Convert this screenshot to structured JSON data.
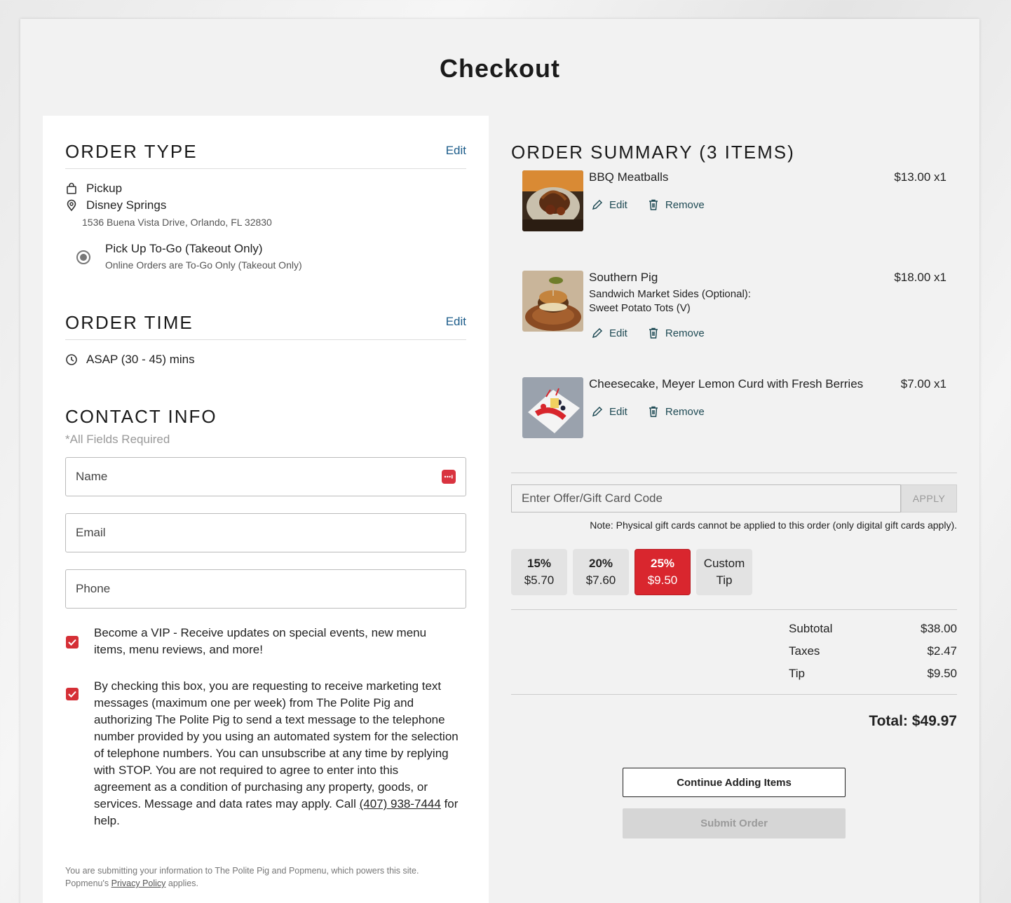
{
  "page": {
    "title": "Checkout"
  },
  "order_type": {
    "heading": "ORDER TYPE",
    "edit_label": "Edit",
    "method": "Pickup",
    "location": "Disney Springs",
    "address": "1536 Buena Vista Drive, Orlando, FL 32830",
    "option_label": "Pick Up To-Go (Takeout Only)",
    "option_sub": "Online Orders are To-Go Only (Takeout Only)"
  },
  "order_time": {
    "heading": "ORDER TIME",
    "edit_label": "Edit",
    "value": "ASAP (30 - 45) mins"
  },
  "contact": {
    "heading": "CONTACT INFO",
    "required_note": "*All Fields Required",
    "name_placeholder": "Name",
    "email_placeholder": "Email",
    "phone_placeholder": "Phone",
    "vip_text": "Become a VIP - Receive updates on special events, new menu items, menu reviews, and more!",
    "sms_text": "By checking this box, you are requesting to receive marketing text messages (maximum one per week) from The Polite Pig and authorizing The Polite Pig to send a text message to the telephone number provided by you using an automated system for the selection of telephone numbers. You can unsubscribe at any time by replying with STOP. You are not required to agree to enter into this agreement as a condition of purchasing any property, goods, or services. Message and data rates may apply. Call ",
    "sms_phone": "(407) 938-7444",
    "sms_tail": " for help.",
    "fine_print_1": "You are submitting your information to The Polite Pig and Popmenu, which powers this site.",
    "fine_print_2a": "Popmenu's ",
    "privacy_link": "Privacy Policy",
    "fine_print_2b": " applies."
  },
  "summary": {
    "heading": "ORDER SUMMARY (3 ITEMS)",
    "edit_label": "Edit",
    "remove_label": "Remove",
    "items": [
      {
        "name": "BBQ Meatballs",
        "price": "$13.00 x1",
        "modifiers": []
      },
      {
        "name": "Southern Pig",
        "price": "$18.00 x1",
        "modifiers": [
          "Sandwich Market Sides (Optional):",
          "Sweet Potato Tots (V)"
        ]
      },
      {
        "name": "Cheesecake, Meyer Lemon Curd with Fresh Berries",
        "price": "$7.00 x1",
        "modifiers": []
      }
    ],
    "promo_placeholder": "Enter Offer/Gift Card Code",
    "apply_label": "APPLY",
    "gift_note": "Note: Physical gift cards cannot be applied to this order (only digital gift cards apply).",
    "tips": [
      {
        "pct": "15%",
        "amount": "$5.70",
        "active": false
      },
      {
        "pct": "20%",
        "amount": "$7.60",
        "active": false
      },
      {
        "pct": "25%",
        "amount": "$9.50",
        "active": true
      },
      {
        "pct": "Custom",
        "amount": "Tip",
        "active": false,
        "custom": true
      }
    ],
    "subtotal_label": "Subtotal",
    "subtotal": "$38.00",
    "taxes_label": "Taxes",
    "taxes": "$2.47",
    "tip_label": "Tip",
    "tip": "$9.50",
    "total": "Total: $49.97",
    "continue_label": "Continue Adding Items",
    "submit_label": "Submit Order"
  }
}
